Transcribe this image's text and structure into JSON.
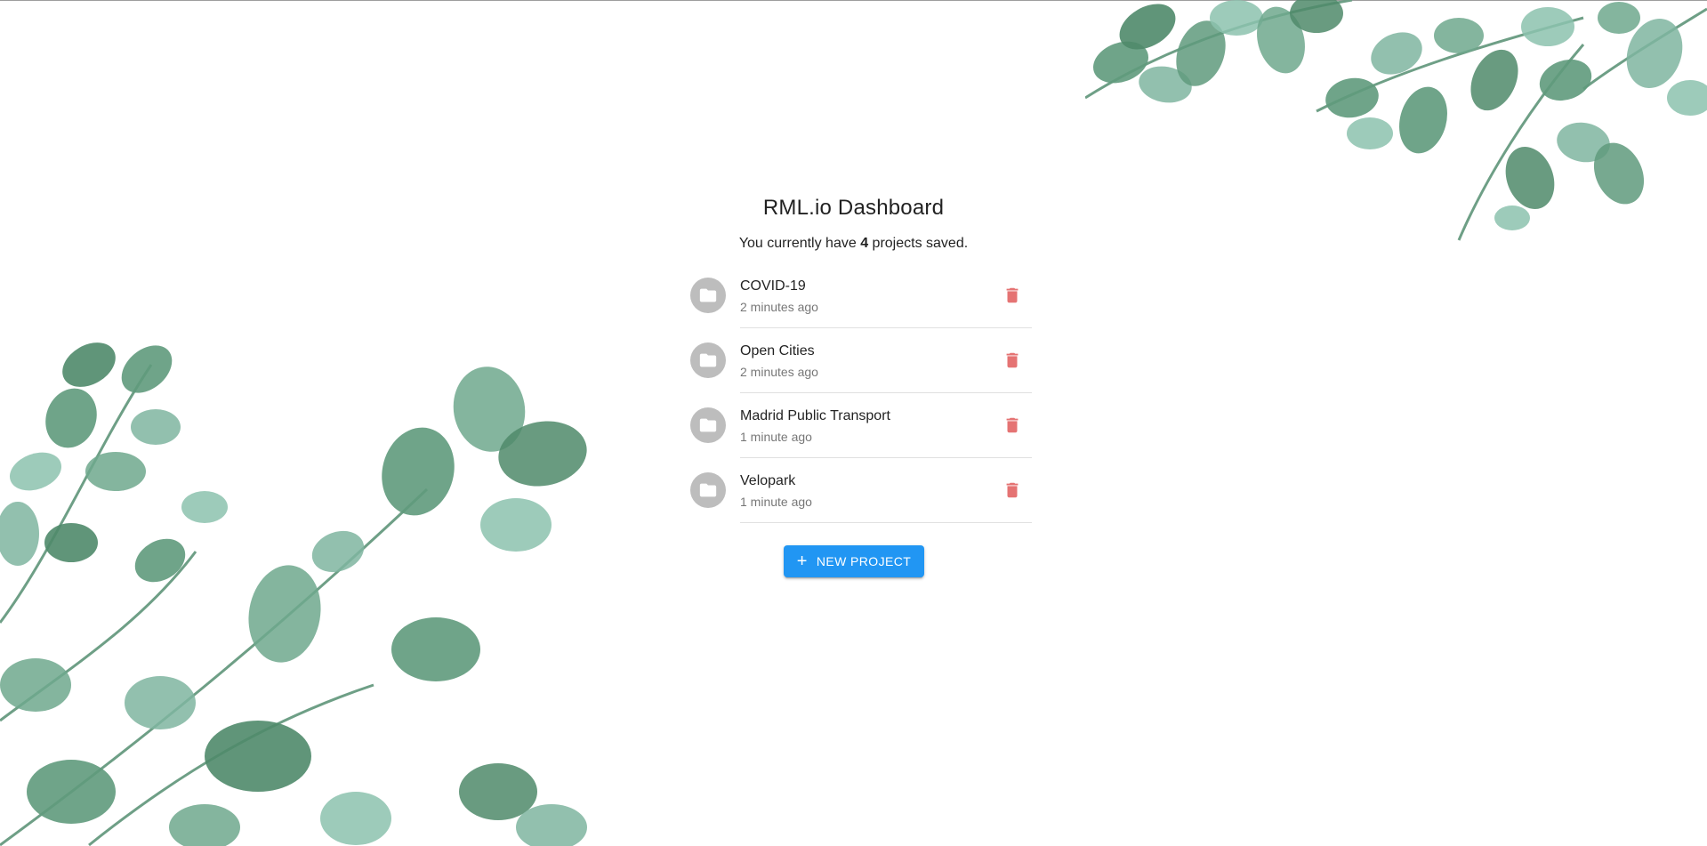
{
  "header": {
    "title": "RML.io Dashboard",
    "subtitle_prefix": "You currently have ",
    "project_count": "4",
    "subtitle_suffix": " projects saved."
  },
  "projects": [
    {
      "name": "COVID-19",
      "time": "2 minutes ago"
    },
    {
      "name": "Open Cities",
      "time": "2 minutes ago"
    },
    {
      "name": "Madrid Public Transport",
      "time": "1 minute ago"
    },
    {
      "name": "Velopark",
      "time": "1 minute ago"
    }
  ],
  "actions": {
    "new_project_label": "NEW PROJECT"
  },
  "icons": {
    "project": "folder-icon",
    "delete": "trash-icon",
    "add": "plus-icon"
  },
  "colors": {
    "primary": "#2196f3",
    "delete": "#e57373",
    "avatar": "#bdbdbd",
    "leaf_dark": "#4f8a6a",
    "leaf_light": "#7fb8a4"
  }
}
